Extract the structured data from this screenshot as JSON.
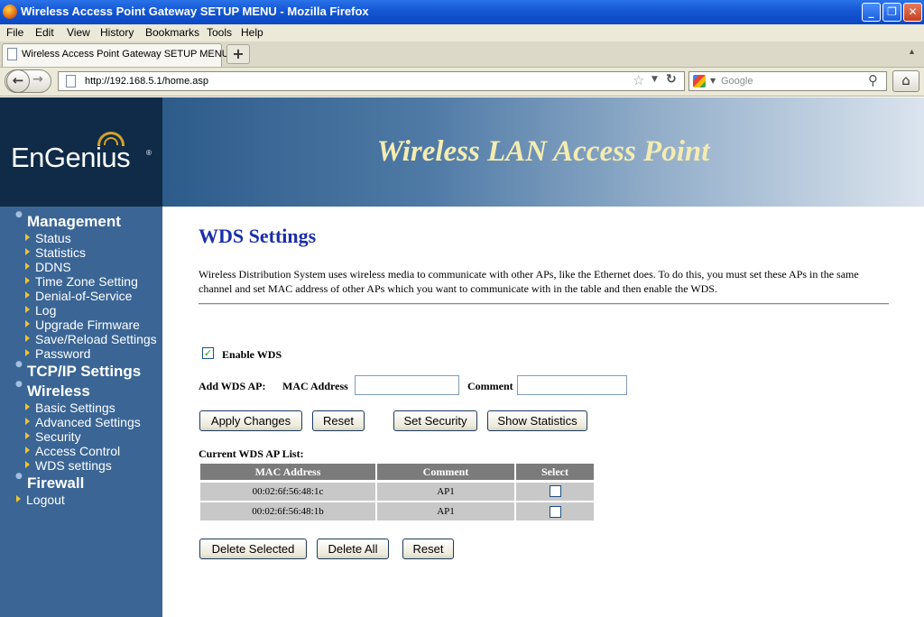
{
  "window": {
    "title": "Wireless Access Point Gateway SETUP MENU - Mozilla Firefox"
  },
  "menu": [
    "File",
    "Edit",
    "View",
    "History",
    "Bookmarks",
    "Tools",
    "Help"
  ],
  "tab": {
    "label": "Wireless Access Point Gateway SETUP MENU"
  },
  "nav": {
    "url": "http://192.168.5.1/home.asp",
    "search_placeholder": "Google"
  },
  "header": {
    "logo": "EnGenius",
    "logo_mark": "®",
    "banner_title": "Wireless LAN Access Point"
  },
  "sidebar": {
    "management": "Management",
    "management_items": [
      "Status",
      "Statistics",
      "DDNS",
      "Time Zone Setting",
      "Denial-of-Service",
      "Log",
      "Upgrade Firmware",
      "Save/Reload Settings",
      "Password"
    ],
    "tcpip": "TCP/IP Settings",
    "wireless": "Wireless",
    "wireless_items": [
      "Basic Settings",
      "Advanced Settings",
      "Security",
      "Access Control",
      "WDS settings"
    ],
    "firewall": "Firewall",
    "logout": "Logout"
  },
  "main": {
    "title": "WDS Settings",
    "description": "Wireless Distribution System uses wireless media to communicate with other APs, like the Ethernet does. To do this, you must set these APs in the same channel and set MAC address of other APs which you want to communicate with in the table and then enable the WDS.",
    "enable_wds_label": "Enable WDS",
    "enable_wds_checked": true,
    "add_label": "Add WDS AP:",
    "mac_label": "MAC Address",
    "mac_value": "",
    "comment_label": "Comment",
    "comment_value": "",
    "buttons": {
      "apply": "Apply Changes",
      "reset": "Reset",
      "security": "Set Security",
      "statistics": "Show Statistics"
    },
    "list_label": "Current WDS AP List:",
    "table": {
      "headers": [
        "MAC Address",
        "Comment",
        "Select"
      ],
      "rows": [
        {
          "mac": "00:02:6f:56:48:1c",
          "comment": "AP1",
          "selected": false
        },
        {
          "mac": "00:02:6f:56:48:1b",
          "comment": "AP1",
          "selected": false
        }
      ]
    },
    "bottom_buttons": {
      "delete_selected": "Delete Selected",
      "delete_all": "Delete All",
      "reset": "Reset"
    }
  }
}
